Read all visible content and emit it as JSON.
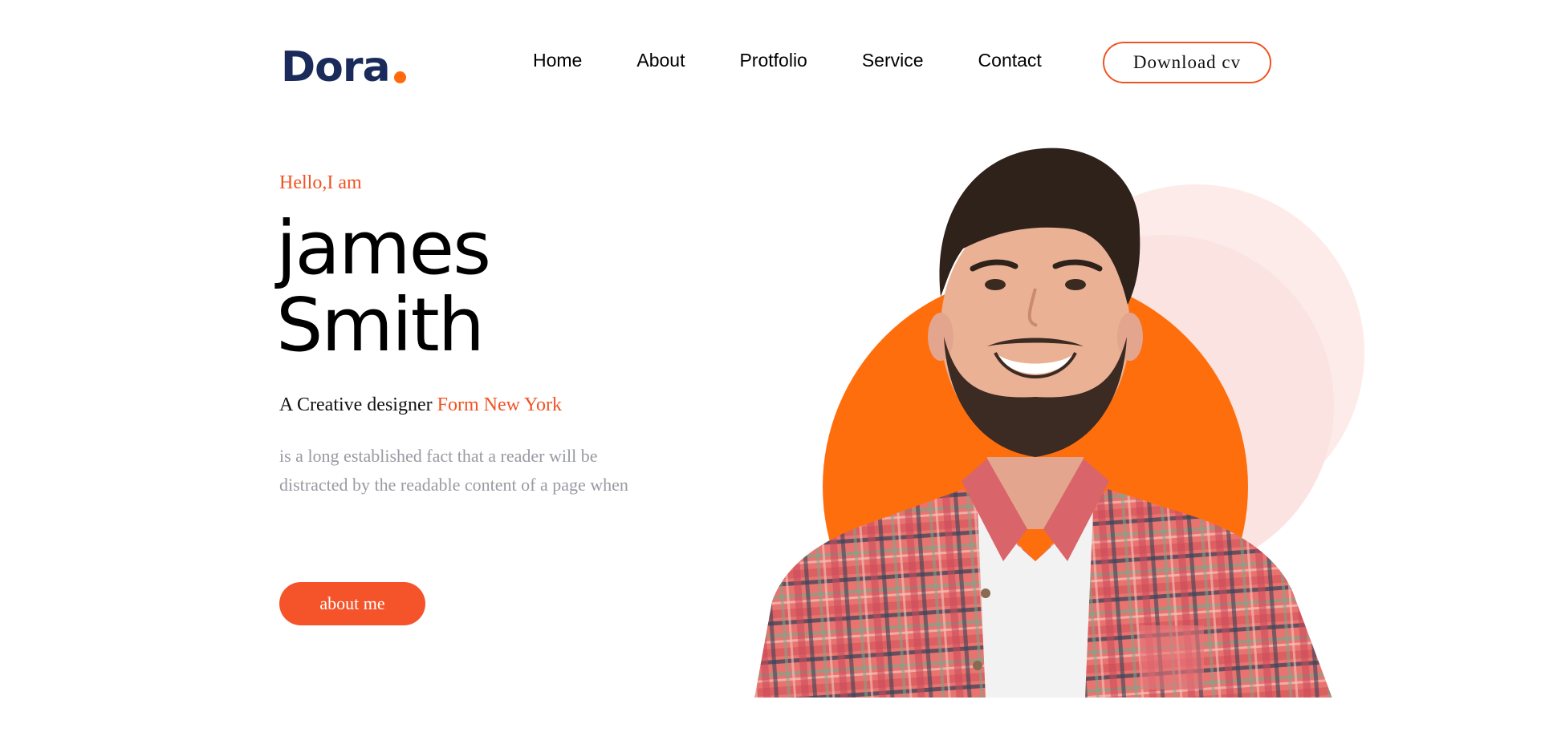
{
  "header": {
    "logo_text": "Dora",
    "nav": [
      "Home",
      "About",
      "Protfolio",
      "Service",
      "Contact"
    ],
    "download_label": "Download cv"
  },
  "hero": {
    "greeting": "Hello,I am",
    "name_first": "james",
    "name_last": "Smith",
    "tagline_prefix": "A Creative designer",
    "tagline_accent": "Form New York",
    "description_line1": "is a long established fact that a reader will be",
    "description_line2": "distracted by the readable content of a page when",
    "cta_label": "about me"
  },
  "colors": {
    "brand_navy": "#1a2a5b",
    "accent_orange": "#ff6b0c",
    "accent_red_orange": "#f05323",
    "soft_pink": "#fde9e7",
    "muted_text": "#999aa3"
  },
  "icons": {
    "logo_dot": "orange-dot",
    "portrait": "smiling-bearded-man-plaid-shirt"
  }
}
